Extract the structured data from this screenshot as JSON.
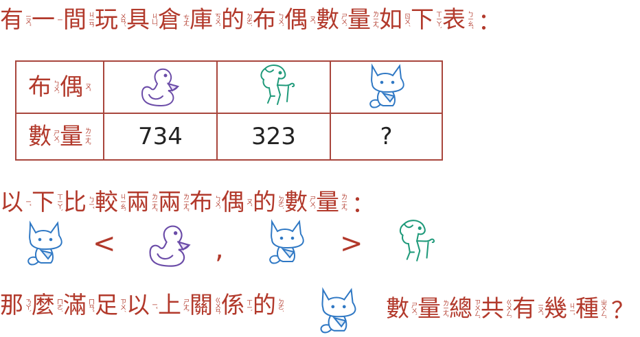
{
  "colors": {
    "text": "#b2392b",
    "duck": "#6b4ca8",
    "horse": "#1f9a7a",
    "fox": "#2f78c4"
  },
  "intro": [
    [
      "有",
      "ㄧㄡˇ"
    ],
    [
      "一",
      "ㄧ"
    ],
    [
      "間",
      "ㄐㄧㄢ"
    ],
    [
      "玩",
      "ㄨㄢˊ"
    ],
    [
      "具",
      "ㄐㄩˋ"
    ],
    [
      "倉",
      "ㄘㄤ"
    ],
    [
      "庫",
      "ㄎㄨˋ"
    ],
    [
      "的",
      "ㄉㄜ˙"
    ],
    [
      "布",
      "ㄅㄨˋ"
    ],
    [
      "偶",
      "ㄡˇ"
    ],
    [
      "數",
      "ㄕㄨˋ"
    ],
    [
      "量",
      "ㄌㄧㄤˋ"
    ],
    [
      "如",
      "ㄖㄨˊ"
    ],
    [
      "下",
      "ㄒㄧㄚˋ"
    ],
    [
      "表",
      "ㄅㄧㄠˇ"
    ]
  ],
  "intro_punct": "：",
  "table": {
    "row1_label": [
      [
        "布",
        "ㄅㄨˋ"
      ],
      [
        "偶",
        "ㄡˇ"
      ]
    ],
    "row2_label": [
      [
        "數",
        "ㄕㄨˋ"
      ],
      [
        "量",
        "ㄌㄧㄤˋ"
      ]
    ],
    "columns": [
      "duck",
      "horse",
      "fox"
    ],
    "values": [
      "734",
      "323",
      "?"
    ]
  },
  "compare_intro": [
    [
      "以",
      "ㄧˇ"
    ],
    [
      "下",
      "ㄒㄧㄚˋ"
    ],
    [
      "比",
      "ㄅㄧˇ"
    ],
    [
      "較",
      "ㄐㄧㄠˋ"
    ],
    [
      "兩",
      "ㄌㄧㄤˇ"
    ],
    [
      "兩",
      "ㄌㄧㄤˇ"
    ],
    [
      "布",
      "ㄅㄨˋ"
    ],
    [
      "偶",
      "ㄡˇ"
    ],
    [
      "的",
      "ㄉㄜ˙"
    ],
    [
      "數",
      "ㄕㄨˋ"
    ],
    [
      "量",
      "ㄌㄧㄤˋ"
    ]
  ],
  "compare_punct": "：",
  "comparisons": {
    "less": "<",
    "comma": ",",
    "greater": ">"
  },
  "question_a": [
    [
      "那",
      "ㄋㄚˋ"
    ],
    [
      "麼",
      "ㄇㄜ˙"
    ],
    [
      "滿",
      "ㄇㄢˇ"
    ],
    [
      "足",
      "ㄗㄨˊ"
    ],
    [
      "以",
      "ㄧˇ"
    ],
    [
      "上",
      "ㄕㄤˋ"
    ],
    [
      "關",
      "ㄍㄨㄢ"
    ],
    [
      "係",
      "ㄒㄧˋ"
    ],
    [
      "的",
      "ㄉㄜ˙"
    ]
  ],
  "question_b": [
    [
      "數",
      "ㄕㄨˋ"
    ],
    [
      "量",
      "ㄌㄧㄤˋ"
    ],
    [
      "總",
      "ㄗㄨㄥˇ"
    ],
    [
      "共",
      "ㄍㄨㄥˋ"
    ],
    [
      "有",
      "ㄧㄡˇ"
    ],
    [
      "幾",
      "ㄐㄧˇ"
    ],
    [
      "種",
      "ㄓㄨㄥˇ"
    ]
  ],
  "question_punct": "？"
}
